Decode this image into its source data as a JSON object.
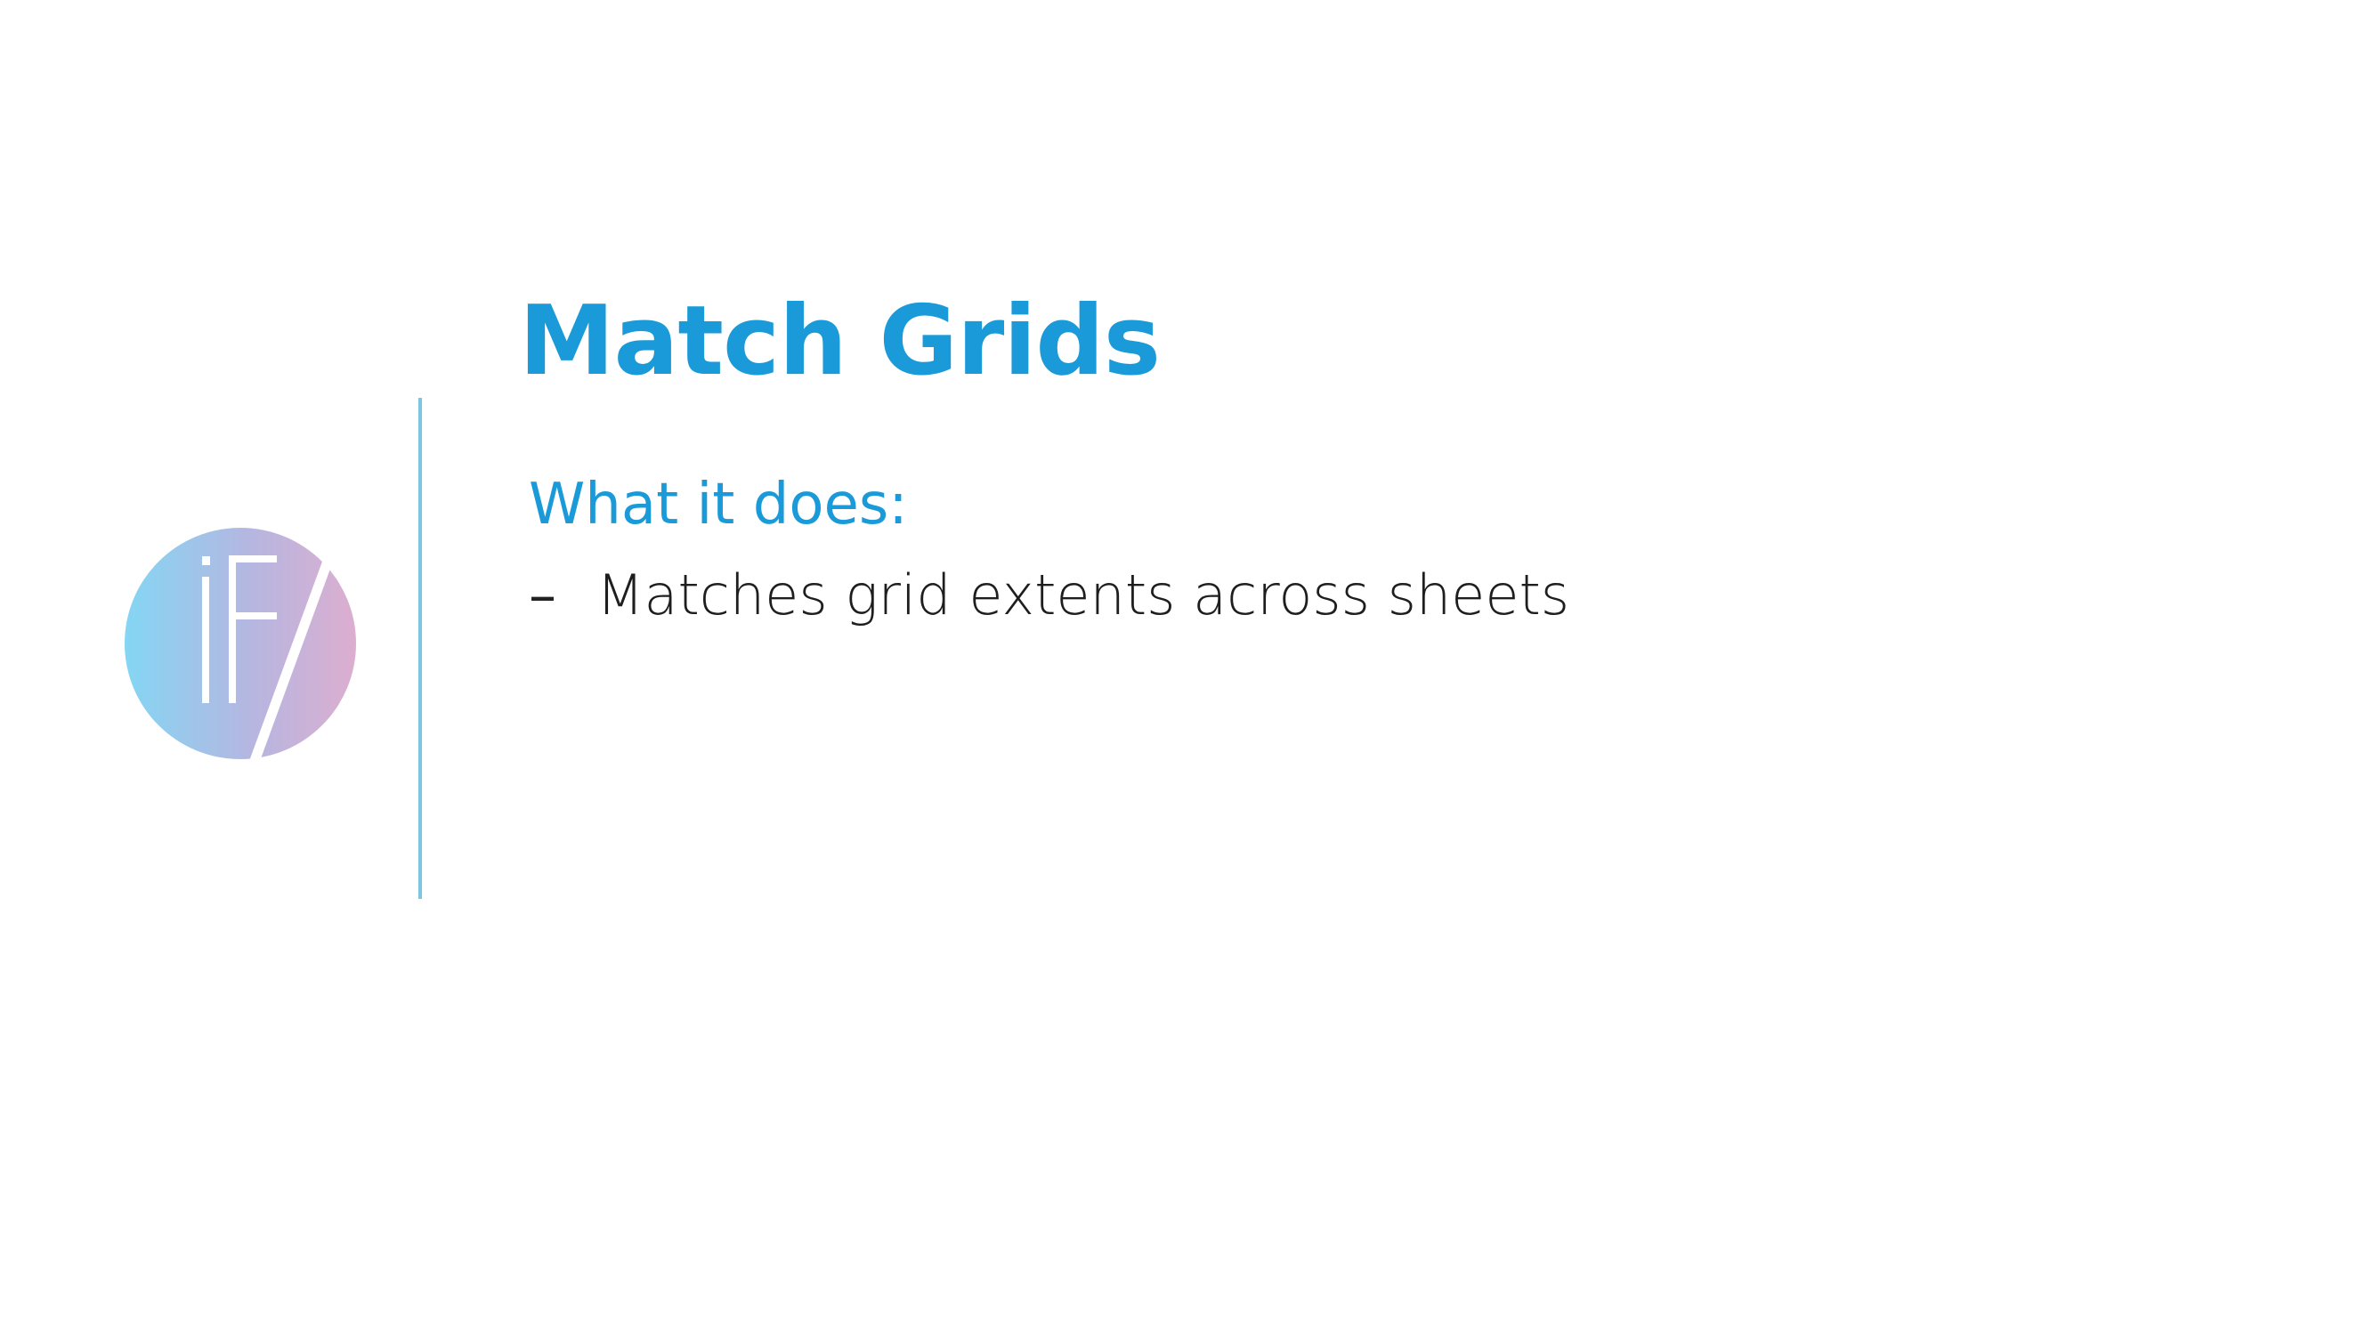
{
  "slide": {
    "title": "Match Grids",
    "subheading": "What it does:",
    "bullets": [
      {
        "marker": "–",
        "text": "Matches grid extents across sheets"
      }
    ]
  },
  "colors": {
    "accent": "#1a9ad8",
    "divider": "#7cc6e0",
    "body_text": "#1e1e1e",
    "logo_gradient_start": "#84d6f4",
    "logo_gradient_mid": "#b6b6e0",
    "logo_gradient_end": "#dcaed0"
  },
  "icons": {
    "logo": "if-slash-logo-icon"
  }
}
